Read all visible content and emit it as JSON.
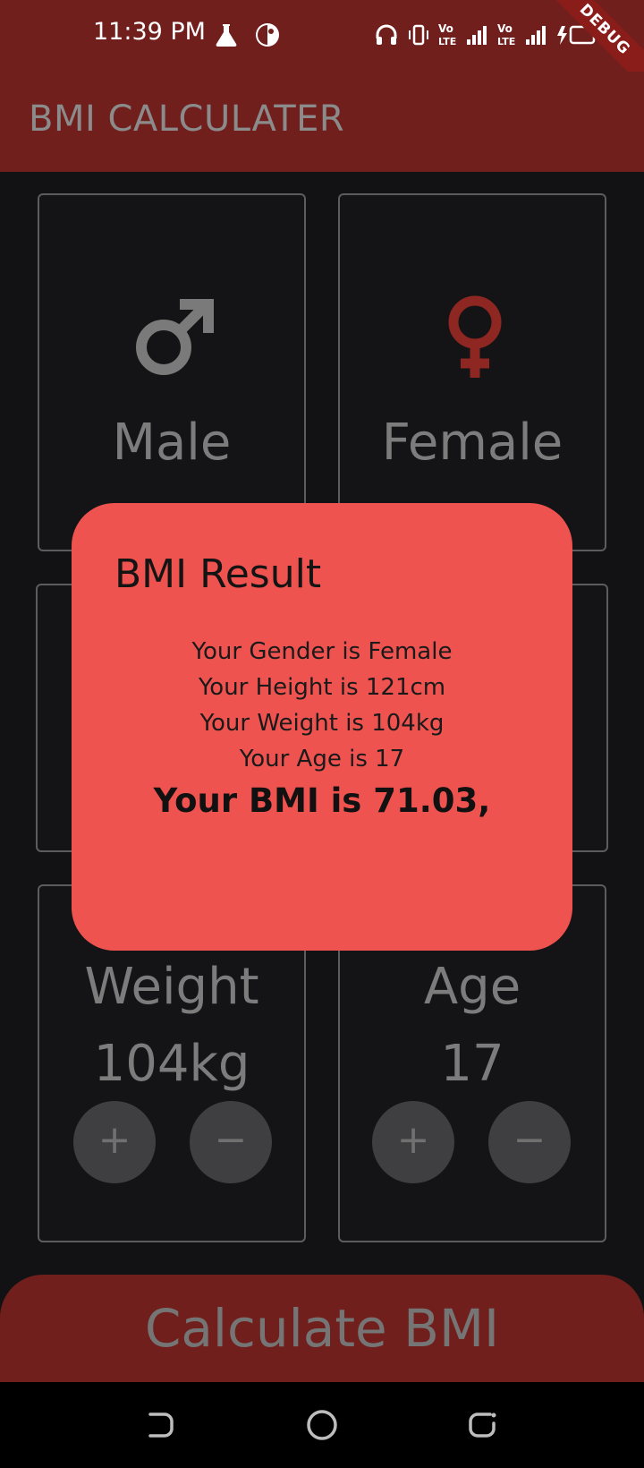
{
  "status_bar": {
    "time": "11:39 PM",
    "left_icons": [
      "flask-icon",
      "app-circle-icon"
    ],
    "right_icons": [
      "headphones-icon",
      "vibrate-icon",
      "volte-signal-1-icon",
      "volte-signal-2-icon",
      "battery-charging-icon"
    ],
    "volte_label_top": "Vo",
    "volte_label_bottom": "LTE"
  },
  "debug_banner": "DEBUG",
  "app_bar": {
    "title": "BMI CALCULATER"
  },
  "gender_cards": {
    "male": {
      "label": "Male",
      "icon": "male-icon",
      "icon_color": "#7a7a7a"
    },
    "female": {
      "label": "Female",
      "icon": "female-icon",
      "icon_color": "#8e2622"
    }
  },
  "weight_card": {
    "label": "Weight",
    "value": "104kg",
    "plus": "+",
    "minus": "−"
  },
  "age_card": {
    "label": "Age",
    "value": "17",
    "plus": "+",
    "minus": "−"
  },
  "calculate_button": {
    "label": "Calculate BMI"
  },
  "dialog": {
    "title": "BMI Result",
    "gender_line": "Your Gender is Female",
    "height_line": "Your Height is 121cm",
    "weight_line": "Your Weight is 104kg",
    "age_line": "Your Age is 17",
    "bmi_line": "Your BMI is 71.03,"
  },
  "nav_bar": {
    "icons": [
      "back-icon",
      "home-icon",
      "recents-icon"
    ]
  },
  "colors": {
    "accent": "#701f1c",
    "dialog_bg": "#ef5350",
    "background": "#121214"
  }
}
